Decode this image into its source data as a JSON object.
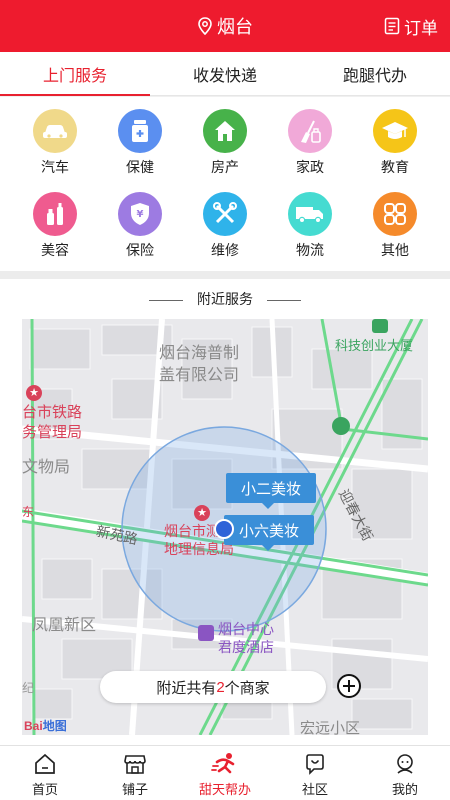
{
  "header": {
    "city": "烟台",
    "orders_label": "订单"
  },
  "tabs": [
    {
      "label": "上门服务",
      "active": true
    },
    {
      "label": "收发快递",
      "active": false
    },
    {
      "label": "跑腿代办",
      "active": false
    }
  ],
  "services": [
    {
      "label": "汽车",
      "icon": "car-icon",
      "color": "#f0d98a"
    },
    {
      "label": "保健",
      "icon": "medicine-icon",
      "color": "#5b8ff0"
    },
    {
      "label": "房产",
      "icon": "house-icon",
      "color": "#47b24a"
    },
    {
      "label": "家政",
      "icon": "cleaning-icon",
      "color": "#f1a9d8"
    },
    {
      "label": "教育",
      "icon": "graduation-cap-icon",
      "color": "#f5c518"
    },
    {
      "label": "美容",
      "icon": "cosmetics-icon",
      "color": "#ef5b8f"
    },
    {
      "label": "保险",
      "icon": "insurance-shield-icon",
      "color": "#9d7be2"
    },
    {
      "label": "维修",
      "icon": "tools-icon",
      "color": "#2fb3ea"
    },
    {
      "label": "物流",
      "icon": "truck-icon",
      "color": "#45dbd1"
    },
    {
      "label": "其他",
      "icon": "grid-icon",
      "color": "#f58a2b"
    }
  ],
  "nearby": {
    "title": "附近服务",
    "merchant_prefix": "附近共有",
    "merchant_count": "2",
    "merchant_suffix": "个商家"
  },
  "map": {
    "labels": {
      "haipu": "烟台海普制",
      "haipu2": "盖有限公司",
      "keji": "科技创业大厦",
      "tielu": "台市铁路",
      "tielu2": "务管理局",
      "wenwu": "文物局",
      "xinyuan": "新苑路",
      "dili1": "烟台市测",
      "dili2": "地理信息局",
      "fenghuang": "凤凰新区",
      "zhongxin1": "烟台中心",
      "zhongxin2": "君度酒店",
      "hongyuan": "宏远小区",
      "yingchun": "迎春大街",
      "left_edge": "东",
      "left_edge2": "纪",
      "baidu": "Bai",
      "baidu2": "地图"
    },
    "markers": [
      "小二美妆",
      "小六美妆"
    ]
  },
  "bottom_nav": [
    {
      "label": "首页",
      "icon": "home-icon",
      "active": false
    },
    {
      "label": "铺子",
      "icon": "shop-icon",
      "active": false
    },
    {
      "label": "甜天帮办",
      "icon": "runner-icon",
      "active": true
    },
    {
      "label": "社区",
      "icon": "community-icon",
      "active": false
    },
    {
      "label": "我的",
      "icon": "profile-icon",
      "active": false
    }
  ],
  "colors": {
    "brand": "#ee1b2e",
    "accent": "#e8212f"
  }
}
